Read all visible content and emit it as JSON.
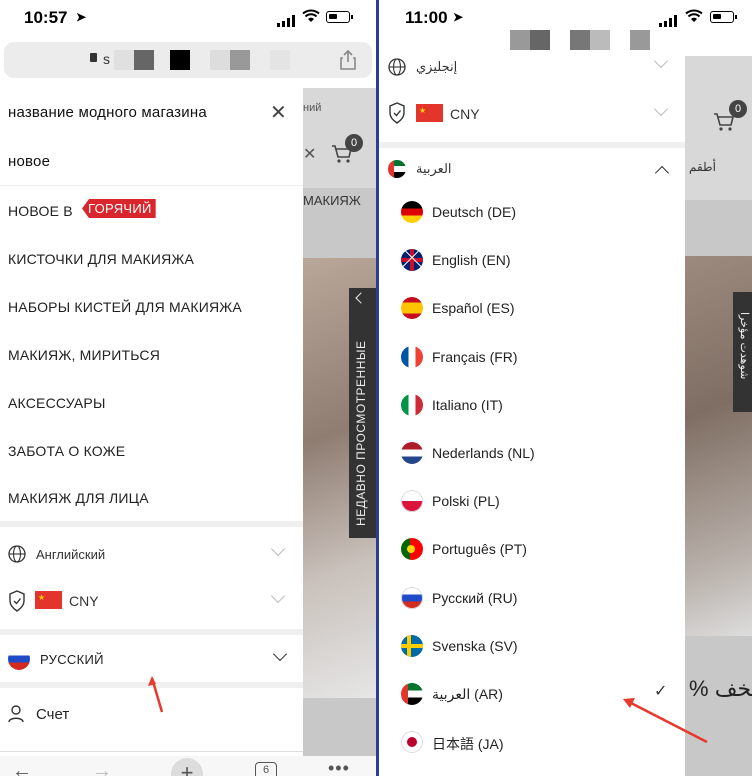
{
  "left": {
    "status_time": "10:57",
    "url_partial": "s",
    "drawer": {
      "search_title": "название модного магазина",
      "items": [
        "новое",
        "НОВОЕ В",
        "КИСТОЧКИ ДЛЯ МАКИЯЖА",
        "НАБОРЫ КИСТЕЙ ДЛЯ МАКИЯЖА",
        "МАКИЯЖ, МИРИТЬСЯ",
        "АКСЕССУАРЫ",
        "ЗАБОТА О КОЖЕ",
        "МАКИЯЖ ДЛЯ ЛИЦА"
      ],
      "hot_badge": "ГОРЯЧИЙ",
      "language_label": "Английский",
      "currency_label": "CNY",
      "russian_label": "РУССКИЙ",
      "account_label": "Счет"
    },
    "bg": {
      "cart_count": "0",
      "vertical_tab": "НЕДАВНО ПРОСМОТРЕННЫЕ",
      "frag_top": "ний",
      "frag_mid": "МАКИЯЖ"
    },
    "tabs_count": "6"
  },
  "right": {
    "status_time": "11:00",
    "top_language_label": "إنجليزي",
    "currency_label": "CNY",
    "arabic_header": "العربية",
    "languages": [
      {
        "label": "Deutsch (DE)",
        "icon": "germany-flag-icon"
      },
      {
        "label": "English (EN)",
        "icon": "uk-flag-icon"
      },
      {
        "label": "Español (ES)",
        "icon": "spain-flag-icon"
      },
      {
        "label": "Français (FR)",
        "icon": "france-flag-icon"
      },
      {
        "label": "Italiano (IT)",
        "icon": "italy-flag-icon"
      },
      {
        "label": "Nederlands (NL)",
        "icon": "netherlands-flag-icon"
      },
      {
        "label": "Polski (PL)",
        "icon": "poland-flag-icon"
      },
      {
        "label": "Português (PT)",
        "icon": "portugal-flag-icon"
      },
      {
        "label": "Русский (RU)",
        "icon": "russia-flag-icon"
      },
      {
        "label": "Svenska (SV)",
        "icon": "sweden-flag-icon"
      },
      {
        "label": "العربية (AR)",
        "icon": "uae-flag-icon",
        "selected": true
      },
      {
        "label": "日本語 (JA)",
        "icon": "japan-flag-icon"
      }
    ],
    "bg": {
      "cart_count": "0",
      "frag_top": "أطقم",
      "frag_bottom": "% تخف",
      "vertical_tab": "شوهدت مؤخرا"
    }
  },
  "colors": {
    "hot_badge": "#d8262c",
    "divider": "#2c3e8f",
    "arrow": "#e8392f"
  }
}
